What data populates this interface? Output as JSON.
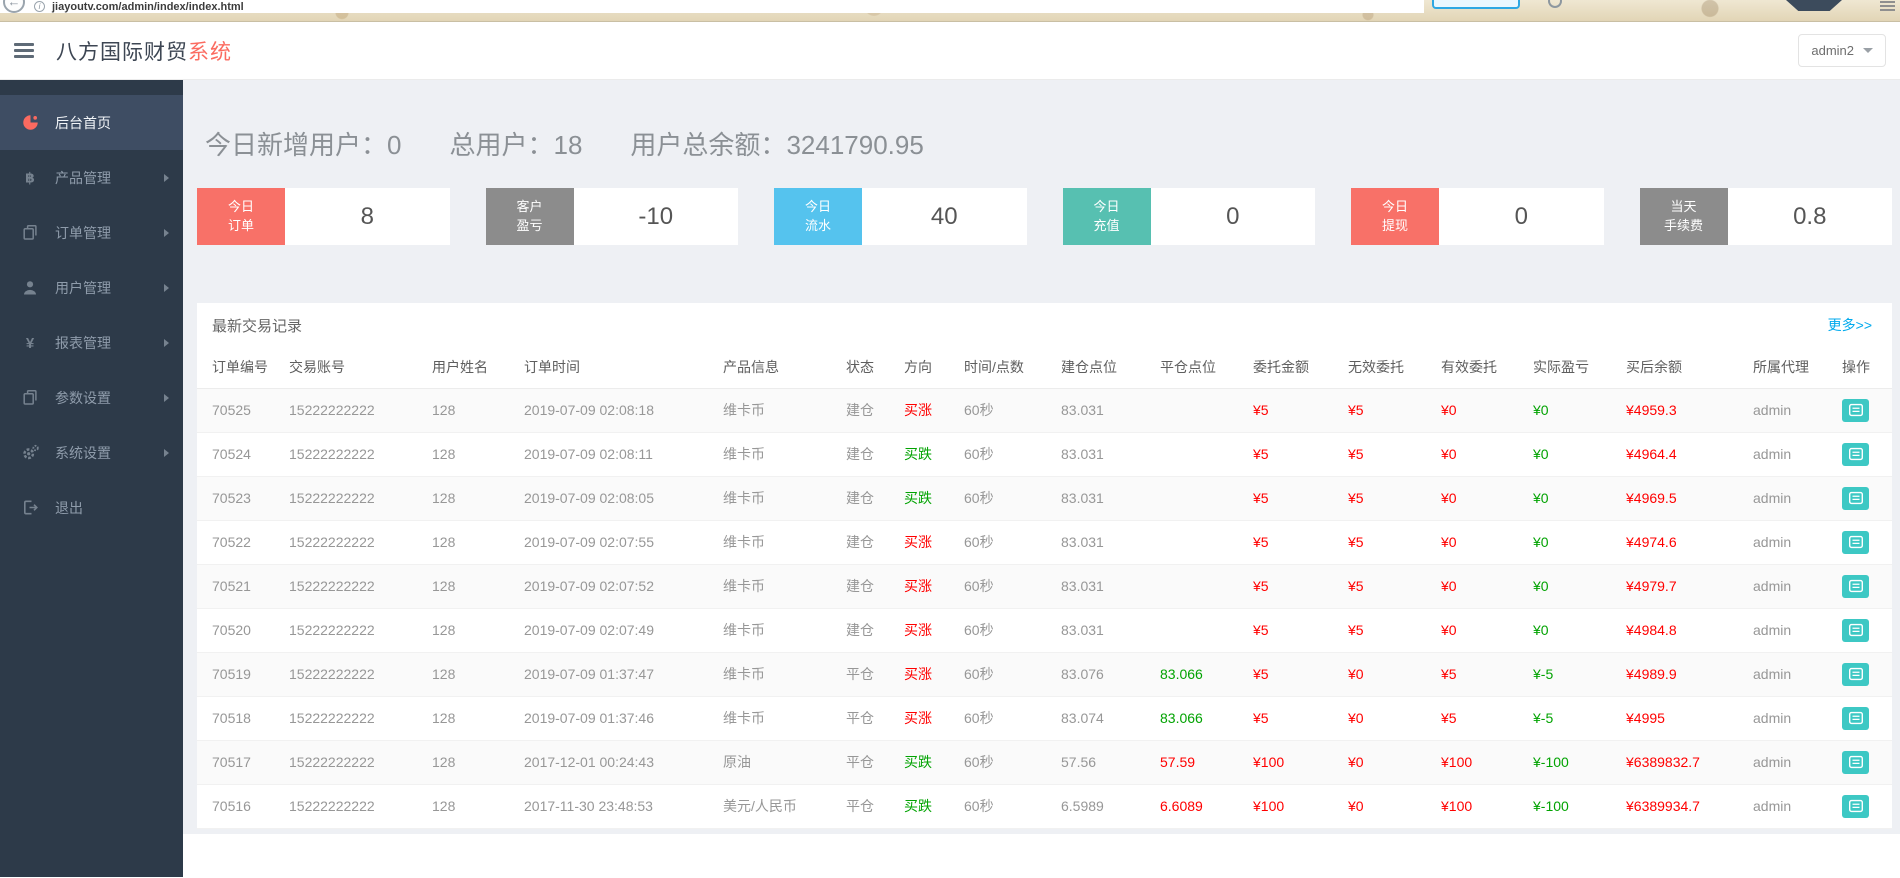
{
  "browser": {
    "url": "jiayoutv.com/admin/index/index.html"
  },
  "header": {
    "title_main": "八方国际财贸",
    "title_accent": "系统",
    "user": "admin2"
  },
  "sidebar": {
    "items": [
      {
        "key": "home",
        "label": "后台首页",
        "icon": "pie-chart-icon",
        "active": true,
        "arrow": false
      },
      {
        "key": "products",
        "label": "产品管理",
        "icon": "bitcoin-icon",
        "active": false,
        "arrow": true
      },
      {
        "key": "orders",
        "label": "订单管理",
        "icon": "copy-icon",
        "active": false,
        "arrow": true
      },
      {
        "key": "users",
        "label": "用户管理",
        "icon": "user-icon",
        "active": false,
        "arrow": true
      },
      {
        "key": "reports",
        "label": "报表管理",
        "icon": "yen-icon",
        "active": false,
        "arrow": true
      },
      {
        "key": "params",
        "label": "参数设置",
        "icon": "copy-icon",
        "active": false,
        "arrow": true
      },
      {
        "key": "system",
        "label": "系统设置",
        "icon": "gear-icon",
        "active": false,
        "arrow": true
      },
      {
        "key": "logout",
        "label": "退出",
        "icon": "logout-icon",
        "active": false,
        "arrow": false
      }
    ]
  },
  "stats": [
    {
      "key": "new-users",
      "label": "今日新增用户：",
      "value": "0"
    },
    {
      "key": "total-users",
      "label": "总用户：",
      "value": "18"
    },
    {
      "key": "total-balance",
      "label": "用户总余额：",
      "value": "3241790.95"
    }
  ],
  "cards": [
    {
      "key": "today-orders",
      "line1": "今日",
      "line2": "订单",
      "value": "8",
      "color": "#f87168"
    },
    {
      "key": "client-profit",
      "line1": "客户",
      "line2": "盈亏",
      "value": "-10",
      "color": "#8c8c8c"
    },
    {
      "key": "today-flow",
      "line1": "今日",
      "line2": "流水",
      "value": "40",
      "color": "#55c3ee"
    },
    {
      "key": "today-recharge",
      "line1": "今日",
      "line2": "充值",
      "value": "0",
      "color": "#57c0b1"
    },
    {
      "key": "today-withdraw",
      "line1": "今日",
      "line2": "提现",
      "value": "0",
      "color": "#f87168"
    },
    {
      "key": "today-fee",
      "line1": "当天",
      "line2": "手续费",
      "value": "0.8",
      "color": "#8c8c8c"
    }
  ],
  "colors": {
    "red": "#ff0000",
    "green": "#02a302",
    "link_blue": "#01AAED"
  },
  "table": {
    "title": "最新交易记录",
    "more": "更多>>",
    "columns": [
      "订单编号",
      "交易账号",
      "用户姓名",
      "订单时间",
      "产品信息",
      "状态",
      "方向",
      "时间/点数",
      "建仓点位",
      "平仓点位",
      "委托金额",
      "无效委托",
      "有效委托",
      "实际盈亏",
      "买后余额",
      "所属代理",
      "操作"
    ],
    "rows": [
      {
        "id": "70525",
        "account": "15222222222",
        "name": "128",
        "time": "2019-07-09 02:08:18",
        "product": "维卡币",
        "status": "建仓",
        "direction": "买涨",
        "dir_color": "red",
        "duration": "60秒",
        "open": "83.031",
        "close": "",
        "close_color": "green",
        "entrust": "¥5",
        "invalid": "¥5",
        "valid": "¥0",
        "profit": "¥0",
        "balance": "¥4959.3",
        "agent": "admin"
      },
      {
        "id": "70524",
        "account": "15222222222",
        "name": "128",
        "time": "2019-07-09 02:08:11",
        "product": "维卡币",
        "status": "建仓",
        "direction": "买跌",
        "dir_color": "green",
        "duration": "60秒",
        "open": "83.031",
        "close": "",
        "close_color": "green",
        "entrust": "¥5",
        "invalid": "¥5",
        "valid": "¥0",
        "profit": "¥0",
        "balance": "¥4964.4",
        "agent": "admin"
      },
      {
        "id": "70523",
        "account": "15222222222",
        "name": "128",
        "time": "2019-07-09 02:08:05",
        "product": "维卡币",
        "status": "建仓",
        "direction": "买跌",
        "dir_color": "green",
        "duration": "60秒",
        "open": "83.031",
        "close": "",
        "close_color": "green",
        "entrust": "¥5",
        "invalid": "¥5",
        "valid": "¥0",
        "profit": "¥0",
        "balance": "¥4969.5",
        "agent": "admin"
      },
      {
        "id": "70522",
        "account": "15222222222",
        "name": "128",
        "time": "2019-07-09 02:07:55",
        "product": "维卡币",
        "status": "建仓",
        "direction": "买涨",
        "dir_color": "red",
        "duration": "60秒",
        "open": "83.031",
        "close": "",
        "close_color": "green",
        "entrust": "¥5",
        "invalid": "¥5",
        "valid": "¥0",
        "profit": "¥0",
        "balance": "¥4974.6",
        "agent": "admin"
      },
      {
        "id": "70521",
        "account": "15222222222",
        "name": "128",
        "time": "2019-07-09 02:07:52",
        "product": "维卡币",
        "status": "建仓",
        "direction": "买涨",
        "dir_color": "red",
        "duration": "60秒",
        "open": "83.031",
        "close": "",
        "close_color": "green",
        "entrust": "¥5",
        "invalid": "¥5",
        "valid": "¥0",
        "profit": "¥0",
        "balance": "¥4979.7",
        "agent": "admin"
      },
      {
        "id": "70520",
        "account": "15222222222",
        "name": "128",
        "time": "2019-07-09 02:07:49",
        "product": "维卡币",
        "status": "建仓",
        "direction": "买涨",
        "dir_color": "red",
        "duration": "60秒",
        "open": "83.031",
        "close": "",
        "close_color": "green",
        "entrust": "¥5",
        "invalid": "¥5",
        "valid": "¥0",
        "profit": "¥0",
        "balance": "¥4984.8",
        "agent": "admin"
      },
      {
        "id": "70519",
        "account": "15222222222",
        "name": "128",
        "time": "2019-07-09 01:37:47",
        "product": "维卡币",
        "status": "平仓",
        "direction": "买涨",
        "dir_color": "red",
        "duration": "60秒",
        "open": "83.076",
        "close": "83.066",
        "close_color": "green",
        "entrust": "¥5",
        "invalid": "¥0",
        "valid": "¥5",
        "profit": "¥-5",
        "balance": "¥4989.9",
        "agent": "admin"
      },
      {
        "id": "70518",
        "account": "15222222222",
        "name": "128",
        "time": "2019-07-09 01:37:46",
        "product": "维卡币",
        "status": "平仓",
        "direction": "买涨",
        "dir_color": "red",
        "duration": "60秒",
        "open": "83.074",
        "close": "83.066",
        "close_color": "green",
        "entrust": "¥5",
        "invalid": "¥0",
        "valid": "¥5",
        "profit": "¥-5",
        "balance": "¥4995",
        "agent": "admin"
      },
      {
        "id": "70517",
        "account": "15222222222",
        "name": "128",
        "time": "2017-12-01 00:24:43",
        "product": "原油",
        "status": "平仓",
        "direction": "买跌",
        "dir_color": "green",
        "duration": "60秒",
        "open": "57.56",
        "close": "57.59",
        "close_color": "red",
        "entrust": "¥100",
        "invalid": "¥0",
        "valid": "¥100",
        "profit": "¥-100",
        "balance": "¥6389832.7",
        "agent": "admin"
      },
      {
        "id": "70516",
        "account": "15222222222",
        "name": "128",
        "time": "2017-11-30 23:48:53",
        "product": "美元/人民币",
        "status": "平仓",
        "direction": "买跌",
        "dir_color": "green",
        "duration": "60秒",
        "open": "6.5989",
        "close": "6.6089",
        "close_color": "red",
        "entrust": "¥100",
        "invalid": "¥0",
        "valid": "¥100",
        "profit": "¥-100",
        "balance": "¥6389934.7",
        "agent": "admin"
      }
    ]
  }
}
